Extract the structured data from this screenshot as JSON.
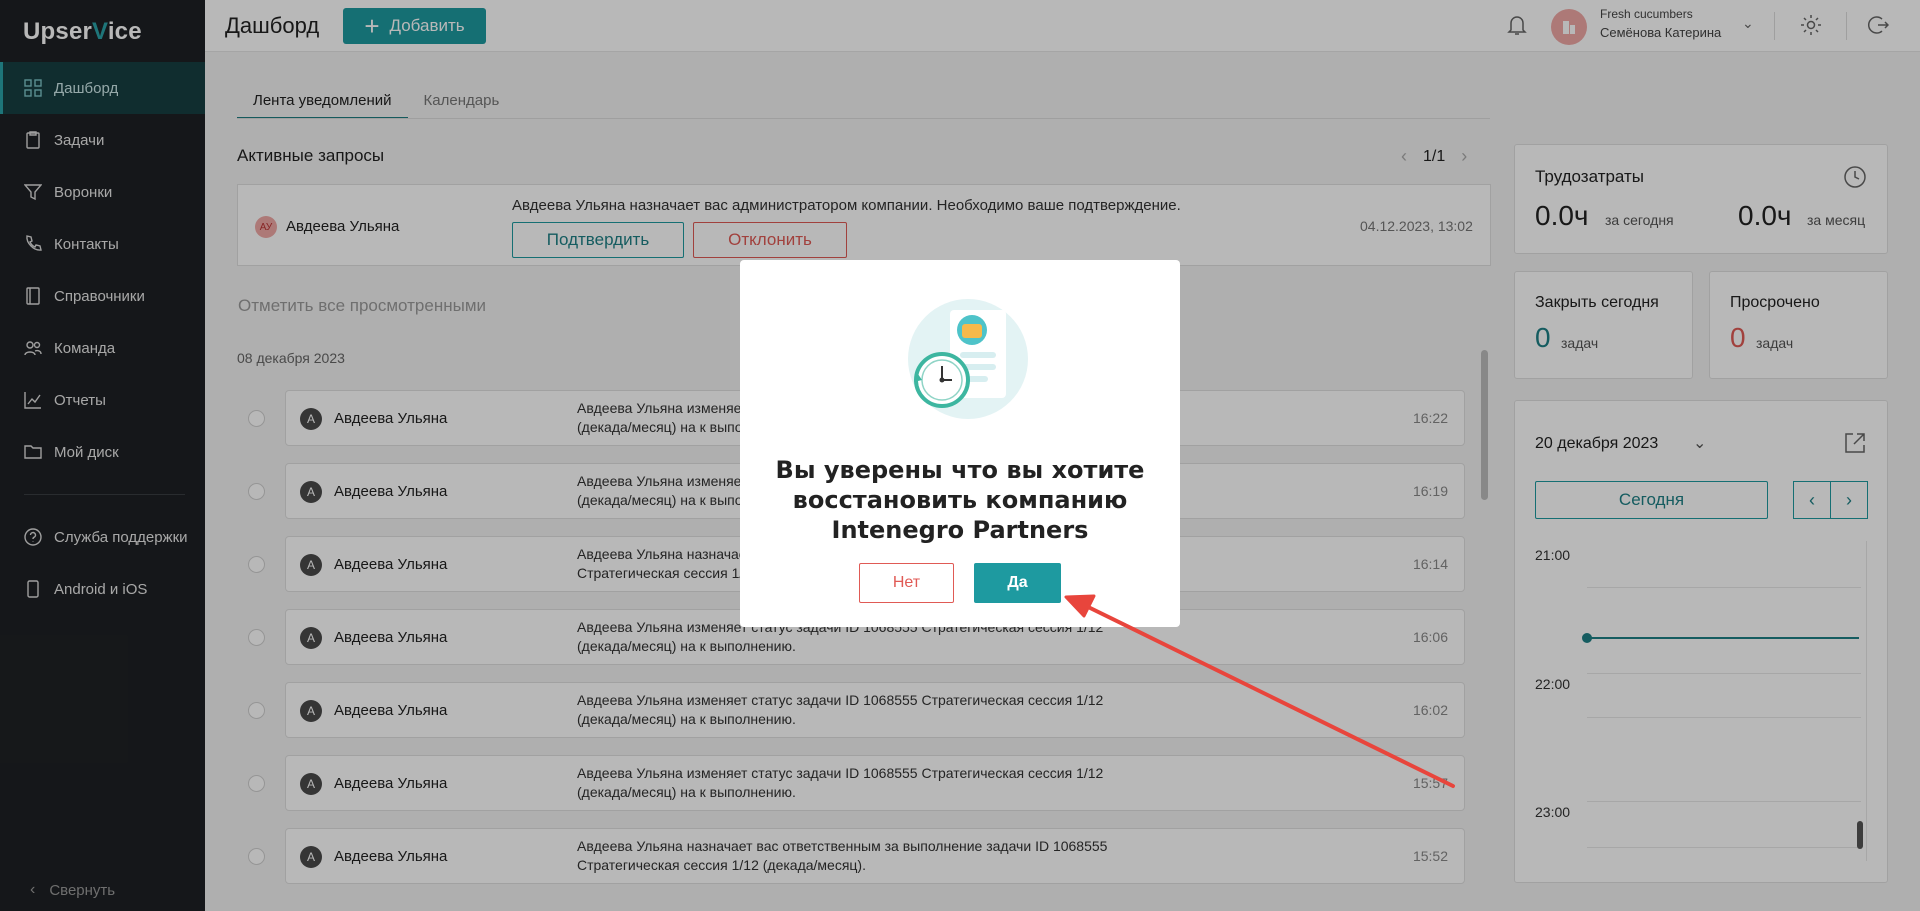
{
  "app": {
    "logo_prefix": "Upser",
    "logo_accent": "V",
    "logo_suffix": "ice"
  },
  "sidebar": {
    "items": [
      {
        "label": "Дашборд",
        "icon": "dashboard-icon"
      },
      {
        "label": "Задачи",
        "icon": "tasks-icon"
      },
      {
        "label": "Воронки",
        "icon": "funnel-icon"
      },
      {
        "label": "Контакты",
        "icon": "phone-icon"
      },
      {
        "label": "Справочники",
        "icon": "book-icon"
      },
      {
        "label": "Команда",
        "icon": "team-icon"
      },
      {
        "label": "Отчеты",
        "icon": "chart-icon"
      },
      {
        "label": "Мой диск",
        "icon": "folder-icon"
      }
    ],
    "bottom_items": [
      {
        "label": "Служба поддержки",
        "icon": "help-icon"
      },
      {
        "label": "Android и iOS",
        "icon": "mobile-icon"
      }
    ],
    "collapse_label": "Свернуть"
  },
  "header": {
    "title": "Дашборд",
    "add_label": "Добавить",
    "company": "Fresh cucumbers",
    "user_name": "Семёнова Катерина"
  },
  "tabs": [
    {
      "label": "Лента уведомлений",
      "active": true
    },
    {
      "label": "Календарь",
      "active": false
    }
  ],
  "active_requests": {
    "title": "Активные запросы",
    "page": "1/1",
    "request": {
      "avatar_initials": "АУ",
      "name": "Авдеева Ульяна",
      "text": "Авдеева Ульяна назначает вас администратором компании. Необходимо ваше подтверждение.",
      "date": "04.12.2023, 13:02",
      "confirm_label": "Подтвердить",
      "decline_label": "Отклонить"
    }
  },
  "feed": {
    "mark_all_label": "Отметить все просмотренными",
    "date_label": "08 декабря 2023",
    "items": [
      {
        "initial": "А",
        "name": "Авдеева Ульяна",
        "line1": "Авдеева Ульяна изменяет статус задачи ID 1068555 Стратегическая сессия 1/12",
        "line2": "(декада/месяц) на к выполнению.",
        "time": "16:22"
      },
      {
        "initial": "А",
        "name": "Авдеева Ульяна",
        "line1": "Авдеева Ульяна изменяет статус задачи ID 1068555 Стратегическая сессия 1/12",
        "line2": "(декада/месяц) на к выполнению.",
        "time": "16:19"
      },
      {
        "initial": "А",
        "name": "Авдеева Ульяна",
        "line1": "Авдеева Ульяна назначает вас ответственным за выполнение задачи ID 1068555",
        "line2": "Стратегическая сессия 1/12 (декада/месяц).",
        "time": "16:14"
      },
      {
        "initial": "А",
        "name": "Авдеева Ульяна",
        "line1": "Авдеева Ульяна изменяет статус задачи ID 1068555 Стратегическая сессия 1/12",
        "line2": "(декада/месяц) на к выполнению.",
        "time": "16:06"
      },
      {
        "initial": "А",
        "name": "Авдеева Ульяна",
        "line1": "Авдеева Ульяна изменяет статус задачи ID 1068555 Стратегическая сессия 1/12",
        "line2": "(декада/месяц) на к выполнению.",
        "time": "16:02"
      },
      {
        "initial": "А",
        "name": "Авдеева Ульяна",
        "line1": "Авдеева Ульяна изменяет статус задачи ID 1068555 Стратегическая сессия 1/12",
        "line2": "(декада/месяц) на к выполнению.",
        "time": "15:57"
      },
      {
        "initial": "А",
        "name": "Авдеева Ульяна",
        "line1": "Авдеева Ульяна назначает вас ответственным за выполнение задачи ID 1068555",
        "line2": "Стратегическая сессия 1/12 (декада/месяц).",
        "time": "15:52"
      }
    ]
  },
  "labor": {
    "title": "Трудозатраты",
    "today_value": "0.0ч",
    "today_label": "за сегодня",
    "month_value": "0.0ч",
    "month_label": "за месяц"
  },
  "kpis": {
    "close_today": {
      "title": "Закрыть сегодня",
      "value": "0",
      "label": "задач",
      "color": "#1e8085"
    },
    "overdue": {
      "title": "Просрочено",
      "value": "0",
      "label": "задач",
      "color": "#e05a55"
    }
  },
  "calendar": {
    "date": "20 декабря 2023",
    "today_label": "Сегодня",
    "hours": [
      "21:00",
      "22:00",
      "23:00"
    ]
  },
  "modal": {
    "title": "Вы уверены что вы хотите восстановить компанию Intenegro Partners",
    "no_label": "Нет",
    "yes_label": "Да"
  },
  "colors": {
    "accent": "#1e9aa0",
    "danger": "#e05a55",
    "sidebar_bg": "#1e2124",
    "annotation_arrow": "#e8453c"
  }
}
